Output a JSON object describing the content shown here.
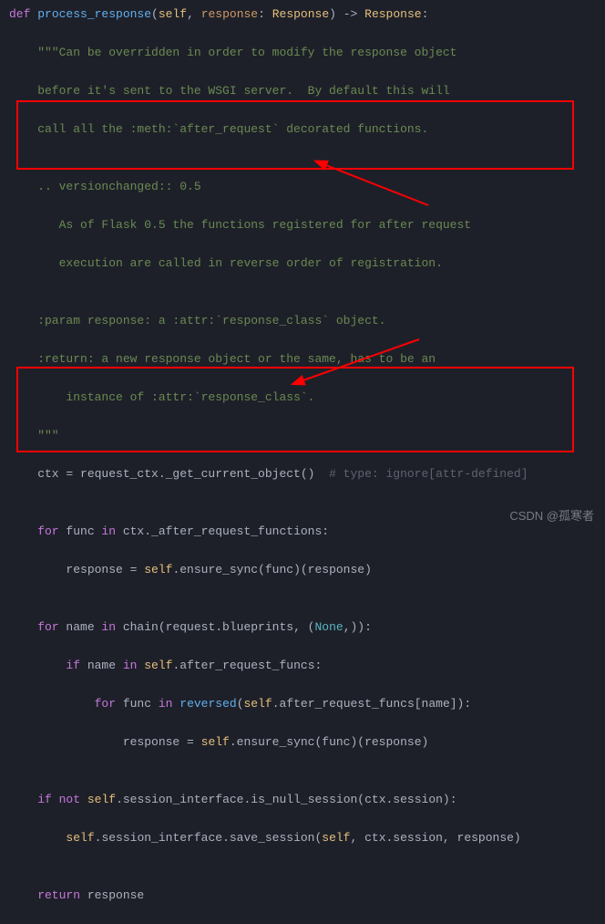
{
  "code": {
    "l1_def": "def",
    "l1_fn": "process_response",
    "l1_sig": "(",
    "l1_self": "self",
    "l1_c1": ", ",
    "l1_p": "response",
    "l1_col": ": ",
    "l1_t1": "Response",
    "l1_arrow": ") -> ",
    "l1_t2": "Response",
    "l1_end": ":",
    "doc1": "    \"\"\"Can be overridden in order to modify the response object",
    "doc2": "    before it's sent to the WSGI server.  By default this will",
    "doc3": "    call all the :meth:`after_request` decorated functions.",
    "blank": "",
    "doc4": "    .. versionchanged:: 0.5",
    "doc5": "       As of Flask 0.5 the functions registered for after request",
    "doc6": "       execution are called in reverse order of registration.",
    "doc7": "    :param response: a :attr:`response_class` object.",
    "doc8": "    :return: a new response object or the same, has to be an",
    "doc9": "        instance of :attr:`response_class`.",
    "doc10": "    \"\"\"",
    "l_ctx_a": "    ctx = request_ctx._get_current_object()  ",
    "l_ctx_cmt": "# type: ignore[attr-defined]",
    "for1_for": "    for",
    "for1_rest": " func ",
    "for1_in": "in",
    "for1_expr": " ctx._after_request_functions:",
    "for1_body_a": "        response = ",
    "for1_body_self": "self",
    "for1_body_b": ".ensure_sync(func)(response)",
    "for2_for": "    for",
    "for2_a": " name ",
    "for2_in": "in",
    "for2_b": " chain(request.blueprints, (",
    "for2_none": "None",
    "for2_c": ",)):",
    "if2_if": "        if",
    "if2_a": " name ",
    "if2_in": "in",
    "if2_b": " ",
    "if2_self": "self",
    "if2_c": ".after_request_funcs:",
    "for3_for": "            for",
    "for3_a": " func ",
    "for3_in": "in",
    "for3_b": " ",
    "for3_rev": "reversed",
    "for3_c": "(",
    "for3_self": "self",
    "for3_d": ".after_request_funcs[name]):",
    "for3_body_a": "                response = ",
    "for3_body_self": "self",
    "for3_body_b": ".ensure_sync(func)(response)",
    "if4_if": "    if",
    "if4_a": " ",
    "if4_not": "not",
    "if4_b": " ",
    "if4_self": "self",
    "if4_c": ".session_interface.is_null_session(ctx.session):",
    "if4_body_a": "        ",
    "if4_body_self": "self",
    "if4_body_b": ".session_interface.save_session(",
    "if4_body_self2": "self",
    "if4_body_c": ", ctx.session, response)",
    "ret_kw": "    return",
    "ret_val": " response"
  },
  "watermark": "CSDN @孤寒者"
}
